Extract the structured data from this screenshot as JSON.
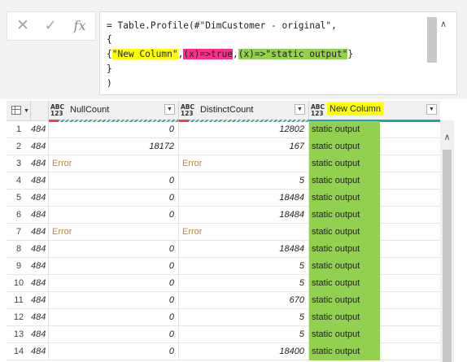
{
  "toolbar": {
    "cancel_icon": "✕",
    "commit_icon": "✓",
    "fx_label": "fx"
  },
  "formula": {
    "line1": "= Table.Profile(#\"DimCustomer - original\",",
    "line2": "{",
    "line3_prefix": "{",
    "line3_name": "\"New Column\"",
    "comma1": ",",
    "line3_condition": "(x)=>true",
    "comma2": ",",
    "line3_output": "(x)=>\"static output\"",
    "line3_suffix": "}",
    "line4": "}",
    "line5": ")",
    "collapse_icon": "∧"
  },
  "grid": {
    "columns": [
      {
        "type": "ABC\n123",
        "name": "NullCount"
      },
      {
        "type": "ABC\n123",
        "name": "DistinctCount"
      },
      {
        "type": "ABC\n123",
        "name": "New Column"
      }
    ],
    "rows": [
      {
        "num": "1",
        "cut": "484",
        "null": "0",
        "distinct": "12802",
        "new": "static output"
      },
      {
        "num": "2",
        "cut": "484",
        "null": "18172",
        "distinct": "167",
        "new": "static output"
      },
      {
        "num": "3",
        "cut": "484",
        "null": "Error",
        "distinct": "Error",
        "new": "static output"
      },
      {
        "num": "4",
        "cut": "484",
        "null": "0",
        "distinct": "5",
        "new": "static output"
      },
      {
        "num": "5",
        "cut": "484",
        "null": "0",
        "distinct": "18484",
        "new": "static output"
      },
      {
        "num": "6",
        "cut": "484",
        "null": "0",
        "distinct": "18484",
        "new": "static output"
      },
      {
        "num": "7",
        "cut": "484",
        "null": "Error",
        "distinct": "Error",
        "new": "static output"
      },
      {
        "num": "8",
        "cut": "484",
        "null": "0",
        "distinct": "18484",
        "new": "static output"
      },
      {
        "num": "9",
        "cut": "484",
        "null": "0",
        "distinct": "5",
        "new": "static output"
      },
      {
        "num": "10",
        "cut": "484",
        "null": "0",
        "distinct": "5",
        "new": "static output"
      },
      {
        "num": "11",
        "cut": "484",
        "null": "0",
        "distinct": "670",
        "new": "static output"
      },
      {
        "num": "12",
        "cut": "484",
        "null": "0",
        "distinct": "5",
        "new": "static output"
      },
      {
        "num": "13",
        "cut": "484",
        "null": "0",
        "distinct": "5",
        "new": "static output"
      },
      {
        "num": "14",
        "cut": "484",
        "null": "0",
        "distinct": "18400",
        "new": "static output"
      }
    ],
    "scroll_up_icon": "∧"
  },
  "colors": {
    "highlight_yellow": "#ffff00",
    "highlight_pink": "#ff2e8a",
    "highlight_green": "#92d050",
    "error_text": "#b08a3a",
    "quality_teal": "#1fa59b"
  }
}
